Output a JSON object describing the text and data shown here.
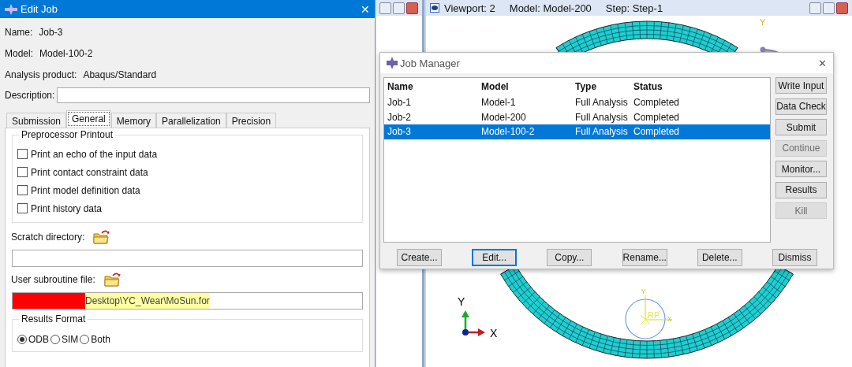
{
  "edit_job": {
    "title": "Edit Job",
    "close": "✕",
    "fields": [
      {
        "label": "Name:",
        "value": "Job-3"
      },
      {
        "label": "Model:",
        "value": "Model-100-2"
      },
      {
        "label": "Analysis product:",
        "value": "Abaqus/Standard"
      }
    ],
    "description": {
      "label": "Description:"
    },
    "tabs": [
      {
        "label": "Submission",
        "selected": false
      },
      {
        "label": "General",
        "selected": true
      },
      {
        "label": "Memory",
        "selected": false
      },
      {
        "label": "Parallelization",
        "selected": false
      },
      {
        "label": "Precision",
        "selected": false
      }
    ],
    "preprocessor_printout": {
      "title": "Preprocessor Printout",
      "options": [
        {
          "label": "Print an echo of the input data",
          "checked": false
        },
        {
          "label": "Print contact constraint data",
          "checked": false
        },
        {
          "label": "Print model definition data",
          "checked": false
        },
        {
          "label": "Print history data",
          "checked": false
        }
      ]
    },
    "scratch_directory": {
      "label": "Scratch directory:"
    },
    "user_subroutine_file": {
      "label": "User subroutine file:",
      "value": "Desktop\\YC_Wear\\MoSun.for"
    },
    "results_format": {
      "title": "Results Format",
      "options": [
        {
          "label": "ODB",
          "selected": true
        },
        {
          "label": "SIM",
          "selected": false
        },
        {
          "label": "Both",
          "selected": false
        }
      ]
    }
  },
  "viewport": {
    "title": "Viewport: 2",
    "model": "Model: Model-200",
    "step": "Step: Step-1",
    "compass_label": "Y",
    "triad": {
      "y": "Y",
      "x": "X"
    },
    "reference_point": {
      "y": "Y",
      "label": "RP",
      "x": "X"
    }
  },
  "job_manager": {
    "title": "Job Manager",
    "close": "✕",
    "columns": [
      "Name",
      "Model",
      "Type",
      "Status"
    ],
    "rows": [
      {
        "cells": [
          "Job-1",
          "Model-1",
          "Full Analysis",
          "Completed"
        ],
        "selected": false
      },
      {
        "cells": [
          "Job-2",
          "Model-200",
          "Full Analysis",
          "Completed"
        ],
        "selected": false
      },
      {
        "cells": [
          "Job-3",
          "Model-100-2",
          "Full Analysis",
          "Completed"
        ],
        "selected": true
      }
    ],
    "side_buttons": [
      {
        "label": "Write Input",
        "disabled": false
      },
      {
        "label": "Data Check",
        "disabled": false
      },
      {
        "label": "Submit",
        "disabled": false
      },
      {
        "label": "Continue",
        "disabled": true
      },
      {
        "label": "Monitor...",
        "disabled": false
      },
      {
        "label": "Results",
        "disabled": false
      },
      {
        "label": "Kill",
        "disabled": true
      }
    ],
    "bottom_buttons": [
      {
        "label": "Create...",
        "focused": false
      },
      {
        "label": "Edit...",
        "focused": true
      },
      {
        "label": "Copy...",
        "focused": false
      },
      {
        "label": "Rename...",
        "focused": false
      },
      {
        "label": "Delete...",
        "focused": false
      },
      {
        "label": "Dismiss",
        "focused": false
      }
    ]
  }
}
